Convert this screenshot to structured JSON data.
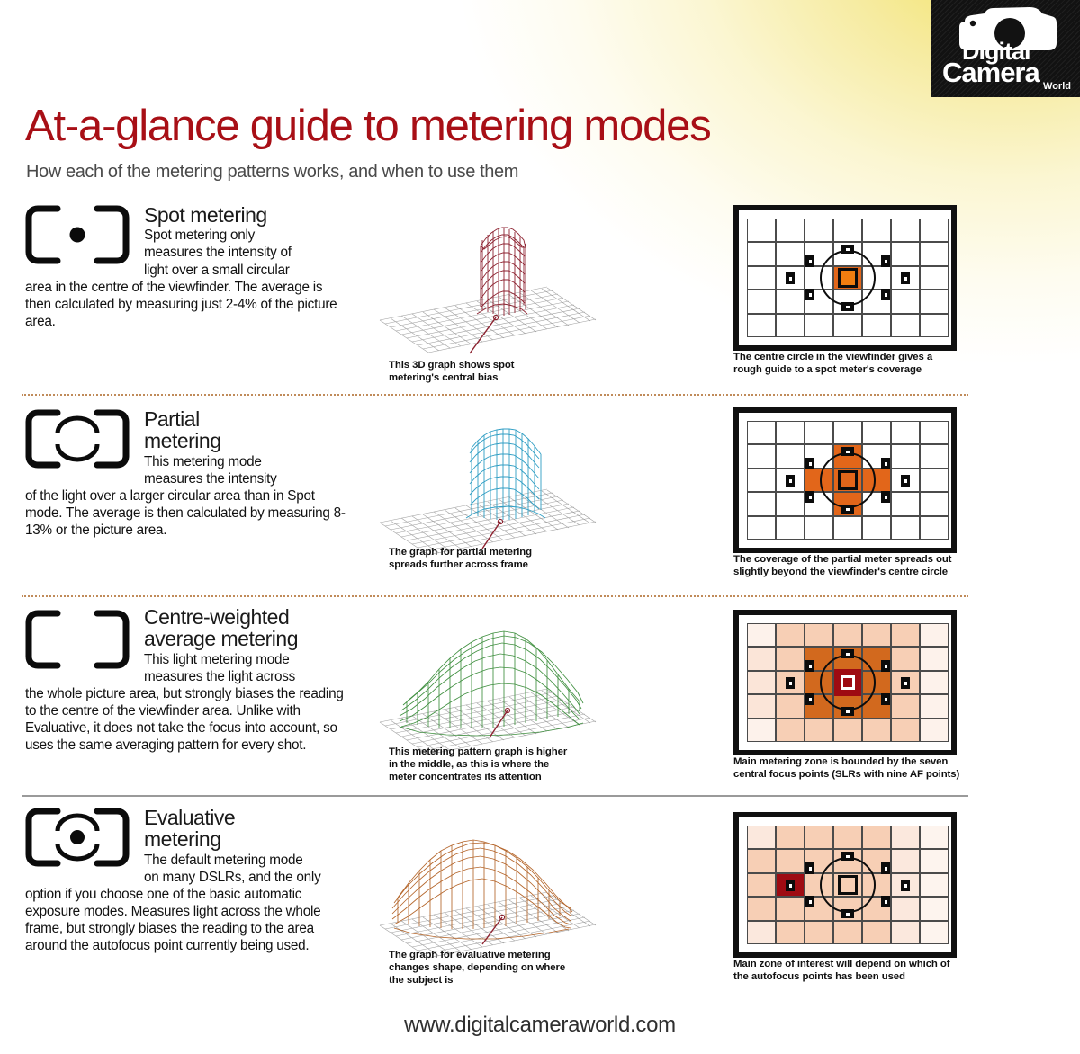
{
  "logo": {
    "line1": "Digital",
    "line2": "Camera",
    "line3": "World",
    "icon": "camera-icon"
  },
  "header": {
    "title": "At-a-glance guide to metering modes",
    "subtitle": "How each of the metering patterns works, and when to use them",
    "title_color": "#a80f16"
  },
  "footer": {
    "url": "www.digitalcameraworld.com"
  },
  "sections": [
    {
      "id": "spot",
      "icon": "spot-metering-icon",
      "title_line1": "Spot metering",
      "title_line2": "",
      "body_indent1": "Spot metering only",
      "body_indent2": "measures the intensity of",
      "body_indent3": "light over a small circular",
      "body_rest": "area in the centre of the viewfinder. The average is then calculated by measuring just 2-4% of the picture area.",
      "graph_caption": "This 3D graph shows spot metering's central bias",
      "graph_color": "#8d2230",
      "vf_caption": "The centre circle in the viewfinder gives a rough guide to a spot meter's coverage"
    },
    {
      "id": "partial",
      "icon": "partial-metering-icon",
      "title_line1": "Partial",
      "title_line2": "metering",
      "body_indent1": "This metering mode",
      "body_indent2": "measures the intensity",
      "body_indent3": "",
      "body_rest": "of the light over a larger circular area than in Spot mode. The average is then calculated by measuring 8-13% or the picture area.",
      "graph_caption": "The graph for partial metering  spreads further across frame",
      "graph_color": "#2f9ec4",
      "vf_caption": "The coverage of the partial meter spreads out slightly beyond the viewfinder's centre circle"
    },
    {
      "id": "centre-weighted",
      "icon": "centre-weighted-metering-icon",
      "title_line1": "Centre-weighted",
      "title_line2": "average metering",
      "body_indent1": "This light metering mode",
      "body_indent2": "measures the light across",
      "body_indent3": "",
      "body_rest": "the whole picture area, but strongly biases the reading to the centre of the viewfinder area. Unlike with Evaluative, it does not take the focus into account, so uses the same averaging pattern for every shot.",
      "graph_caption": "This metering pattern graph is higher in the middle, as this is where the meter concentrates its attention",
      "graph_color": "#3f8f3f",
      "vf_caption": "Main metering zone is bounded by the seven central focus points (SLRs with nine AF points)"
    },
    {
      "id": "evaluative",
      "icon": "evaluative-metering-icon",
      "title_line1": "Evaluative",
      "title_line2": "metering",
      "body_indent1": "The default metering mode",
      "body_indent2": "on many DSLRs, and the only",
      "body_indent3": "",
      "body_rest": "option if you choose one of the basic automatic exposure modes. Measures light across the whole frame, but strongly biases the reading to the area around the autofocus point currently being used.",
      "graph_caption": "The graph for evaluative metering changes shape, depending on where the subject is",
      "graph_color": "#b4652a",
      "vf_caption": "Main zone of interest will depend on which of the autofocus points has been used"
    }
  ],
  "colors": {
    "orange_bright": "#f07d10",
    "orange_mid": "#e2661a",
    "orange_dark": "#d2691e",
    "salmon_light": "#f7cfb5",
    "salmon_pale": "#fbeadf",
    "dark_red": "#9e0b12",
    "divider": "#c08b5a",
    "logo_bg": "#121212"
  },
  "viewfinder_spec": {
    "columns": 7,
    "rows": 5,
    "af_points": 9,
    "note": "center circle marks spot/partial metering coverage"
  },
  "chart_data": [
    {
      "type": "surface",
      "title": "Spot metering distribution",
      "series_name": "spot",
      "color": "#8d2230",
      "grid": "30x22 mesh plane",
      "peak_height": 0.95,
      "peak_width_fraction": 0.14,
      "description": "single very narrow tall column at plane centre"
    },
    {
      "type": "surface",
      "title": "Partial metering distribution",
      "series_name": "partial",
      "color": "#2f9ec4",
      "grid": "30x22 mesh plane",
      "peak_height": 0.92,
      "peak_width_fraction": 0.24,
      "description": "wider tall column at plane centre with flat top"
    },
    {
      "type": "surface",
      "title": "Centre-weighted average metering distribution",
      "series_name": "centre-weighted",
      "color": "#3f8f3f",
      "grid": "30x22 mesh plane",
      "peak_height": 0.72,
      "peak_width_fraction": 0.62,
      "description": "broad rounded dome covering most of the frame, highest in middle"
    },
    {
      "type": "surface",
      "title": "Evaluative metering distribution",
      "series_name": "evaluative",
      "color": "#b4652a",
      "grid": "30x22 mesh plane",
      "peak_height": 0.6,
      "peak_width_fraction": 0.78,
      "description": "broad irregular plateau biased to the left / autofocus point"
    }
  ]
}
